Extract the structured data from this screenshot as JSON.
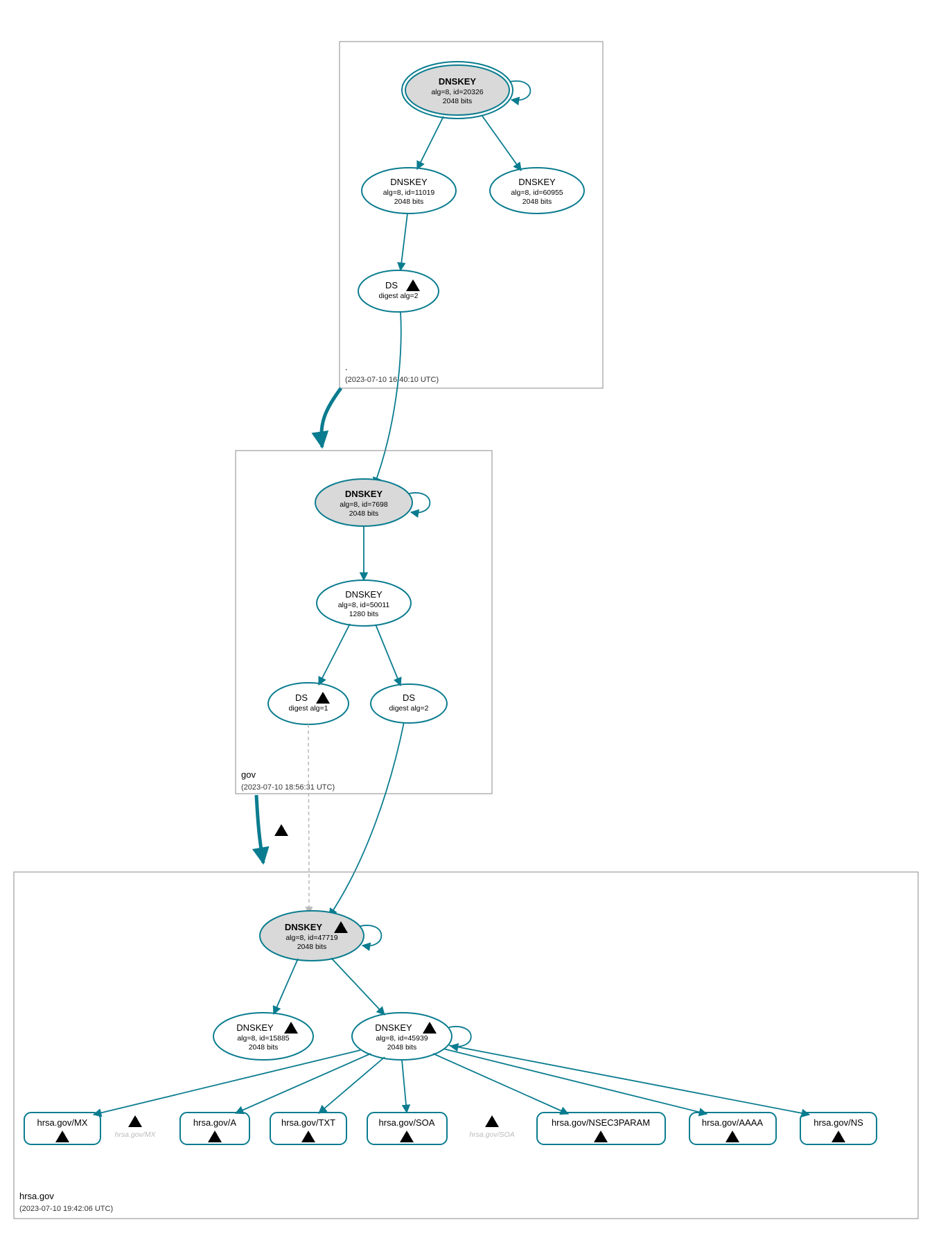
{
  "colors": {
    "edge": "#0a7c8f",
    "ksk_fill": "#d9d9d9",
    "warn": "#ffd54a",
    "err": "#c00000"
  },
  "zones": {
    "root": {
      "name": ".",
      "timestamp": "(2023-07-10 16:40:10 UTC)"
    },
    "gov": {
      "name": "gov",
      "timestamp": "(2023-07-10 18:56:31 UTC)"
    },
    "hrsa": {
      "name": "hrsa.gov",
      "timestamp": "(2023-07-10 19:42:06 UTC)"
    }
  },
  "nodes": {
    "root_ksk": {
      "title": "DNSKEY",
      "l1": "alg=8, id=20326",
      "l2": "2048 bits"
    },
    "root_zsk1": {
      "title": "DNSKEY",
      "l1": "alg=8, id=11019",
      "l2": "2048 bits"
    },
    "root_zsk2": {
      "title": "DNSKEY",
      "l1": "alg=8, id=60955",
      "l2": "2048 bits"
    },
    "root_ds": {
      "title": "DS",
      "l1": "digest alg=2"
    },
    "gov_ksk": {
      "title": "DNSKEY",
      "l1": "alg=8, id=7698",
      "l2": "2048 bits"
    },
    "gov_zsk": {
      "title": "DNSKEY",
      "l1": "alg=8, id=50011",
      "l2": "1280 bits"
    },
    "gov_ds1": {
      "title": "DS",
      "l1": "digest alg=1"
    },
    "gov_ds2": {
      "title": "DS",
      "l1": "digest alg=2"
    },
    "hrsa_ksk": {
      "title": "DNSKEY",
      "l1": "alg=8, id=47719",
      "l2": "2048 bits"
    },
    "hrsa_zsk1": {
      "title": "DNSKEY",
      "l1": "alg=8, id=15885",
      "l2": "2048 bits"
    },
    "hrsa_zsk2": {
      "title": "DNSKEY",
      "l1": "alg=8, id=45939",
      "l2": "2048 bits"
    },
    "rr_mx": {
      "label": "hrsa.gov/MX"
    },
    "rr_a": {
      "label": "hrsa.gov/A"
    },
    "rr_txt": {
      "label": "hrsa.gov/TXT"
    },
    "rr_soa": {
      "label": "hrsa.gov/SOA"
    },
    "rr_nsec3": {
      "label": "hrsa.gov/NSEC3PARAM"
    },
    "rr_aaaa": {
      "label": "hrsa.gov/AAAA"
    },
    "rr_ns": {
      "label": "hrsa.gov/NS"
    },
    "ghost_mx": {
      "label": "hrsa.gov/MX"
    },
    "ghost_soa": {
      "label": "hrsa.gov/SOA"
    }
  }
}
